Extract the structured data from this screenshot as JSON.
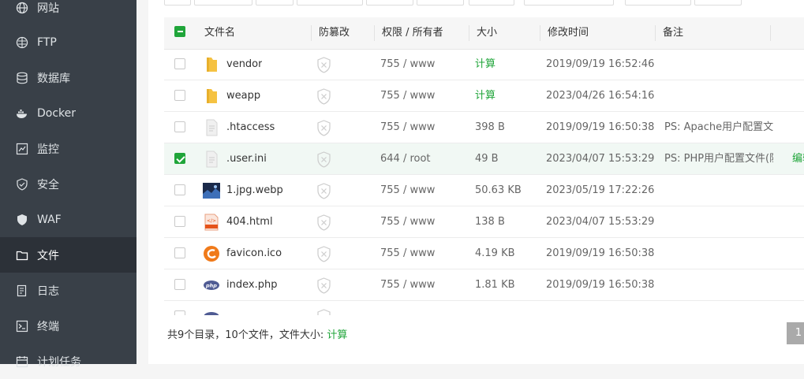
{
  "sidebar": {
    "items": [
      {
        "label": "网站",
        "icon": "globe-icon"
      },
      {
        "label": "FTP",
        "icon": "ftp-icon"
      },
      {
        "label": "数据库",
        "icon": "database-icon"
      },
      {
        "label": "Docker",
        "icon": "docker-icon"
      },
      {
        "label": "监控",
        "icon": "monitor-icon"
      },
      {
        "label": "安全",
        "icon": "shield-icon"
      },
      {
        "label": "WAF",
        "icon": "waf-shield-icon"
      },
      {
        "label": "文件",
        "icon": "folder-icon",
        "active": true
      },
      {
        "label": "日志",
        "icon": "log-icon"
      },
      {
        "label": "终端",
        "icon": "terminal-icon"
      },
      {
        "label": "计划任务",
        "icon": "task-icon"
      }
    ]
  },
  "table": {
    "headers": {
      "name": "文件名",
      "tamper": "防篡改",
      "perm": "权限 / 所有者",
      "size": "大小",
      "mtime": "修改时间",
      "note": "备注"
    },
    "rows": [
      {
        "name": "vendor",
        "type": "folder",
        "perm": "755 / www",
        "size": "计算",
        "size_is_action": true,
        "mtime": "2019/09/19 16:52:46",
        "note": "",
        "checked": false
      },
      {
        "name": "weapp",
        "type": "folder",
        "perm": "755 / www",
        "size": "计算",
        "size_is_action": true,
        "mtime": "2023/04/26 16:54:16",
        "note": "",
        "checked": false
      },
      {
        "name": ".htaccess",
        "type": "file",
        "perm": "755 / www",
        "size": "398 B",
        "mtime": "2019/09/19 16:50:38",
        "note": "PS: Apache用户配置文件",
        "checked": false
      },
      {
        "name": ".user.ini",
        "type": "file",
        "perm": "644 / root",
        "size": "49 B",
        "mtime": "2023/04/07 15:53:29",
        "note": "PS: PHP用户配置文件(防",
        "checked": true,
        "action": "编辑"
      },
      {
        "name": "1.jpg.webp",
        "type": "image",
        "perm": "755 / www",
        "size": "50.63 KB",
        "mtime": "2023/05/19 17:22:26",
        "note": "",
        "checked": false
      },
      {
        "name": "404.html",
        "type": "html",
        "perm": "755 / www",
        "size": "138 B",
        "mtime": "2023/04/07 15:53:29",
        "note": "",
        "checked": false
      },
      {
        "name": "favicon.ico",
        "type": "ico",
        "perm": "755 / www",
        "size": "4.19 KB",
        "mtime": "2019/09/19 16:50:38",
        "note": "",
        "checked": false
      },
      {
        "name": "index.php",
        "type": "php",
        "perm": "755 / www",
        "size": "1.81 KB",
        "mtime": "2019/09/19 16:50:38",
        "note": "",
        "checked": false
      }
    ]
  },
  "footer": {
    "summary": "共9个目录，10个文件，文件大小:",
    "calc": "计算",
    "page": "1"
  },
  "colors": {
    "accent": "#20a53a",
    "sidebar_bg": "#394048",
    "sidebar_active": "#2c3138"
  }
}
